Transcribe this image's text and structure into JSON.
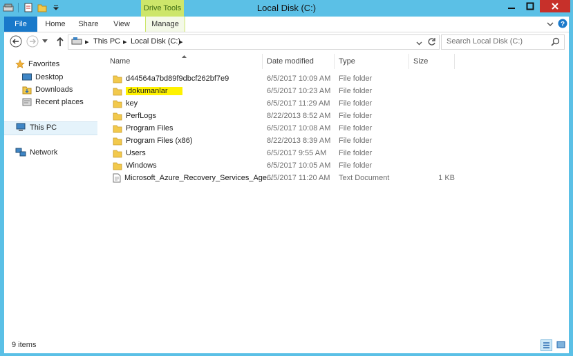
{
  "window": {
    "title": "Local Disk (C:)",
    "context_tab": "Drive Tools"
  },
  "ribbon": {
    "tabs": [
      "File",
      "Home",
      "Share",
      "View",
      "Manage"
    ]
  },
  "address": {
    "crumbs": [
      "This PC",
      "Local Disk (C:)"
    ],
    "search_placeholder": "Search Local Disk (C:)"
  },
  "nav": {
    "favorites": "Favorites",
    "desktop": "Desktop",
    "downloads": "Downloads",
    "recent": "Recent places",
    "this_pc": "This PC",
    "network": "Network"
  },
  "columns": {
    "name": "Name",
    "date": "Date modified",
    "type": "Type",
    "size": "Size"
  },
  "files": [
    {
      "name": "d44564a7bd89f9dbcf262bf7e9",
      "date": "6/5/2017 10:09 AM",
      "type": "File folder",
      "size": "",
      "icon": "folder-icon"
    },
    {
      "name": "dokumanlar",
      "date": "6/5/2017 10:23 AM",
      "type": "File folder",
      "size": "",
      "icon": "folder-icon",
      "highlighted": true
    },
    {
      "name": "key",
      "date": "6/5/2017 11:29 AM",
      "type": "File folder",
      "size": "",
      "icon": "folder-icon"
    },
    {
      "name": "PerfLogs",
      "date": "8/22/2013 8:52 AM",
      "type": "File folder",
      "size": "",
      "icon": "folder-icon"
    },
    {
      "name": "Program Files",
      "date": "6/5/2017 10:08 AM",
      "type": "File folder",
      "size": "",
      "icon": "folder-icon"
    },
    {
      "name": "Program Files (x86)",
      "date": "8/22/2013 8:39 AM",
      "type": "File folder",
      "size": "",
      "icon": "folder-icon"
    },
    {
      "name": "Users",
      "date": "6/5/2017 9:55 AM",
      "type": "File folder",
      "size": "",
      "icon": "folder-icon"
    },
    {
      "name": "Windows",
      "date": "6/5/2017 10:05 AM",
      "type": "File folder",
      "size": "",
      "icon": "folder-icon"
    },
    {
      "name": "Microsoft_Azure_Recovery_Services_Age...",
      "date": "6/5/2017 11:20 AM",
      "type": "Text Document",
      "size": "1 KB",
      "icon": "text-document-icon"
    }
  ],
  "status": {
    "count": "9 items"
  },
  "colors": {
    "frame": "#5bc0e6",
    "file_tab": "#1979ca",
    "drive_tools": "#cde66a",
    "close": "#c7302a",
    "highlight": "#fff200"
  }
}
